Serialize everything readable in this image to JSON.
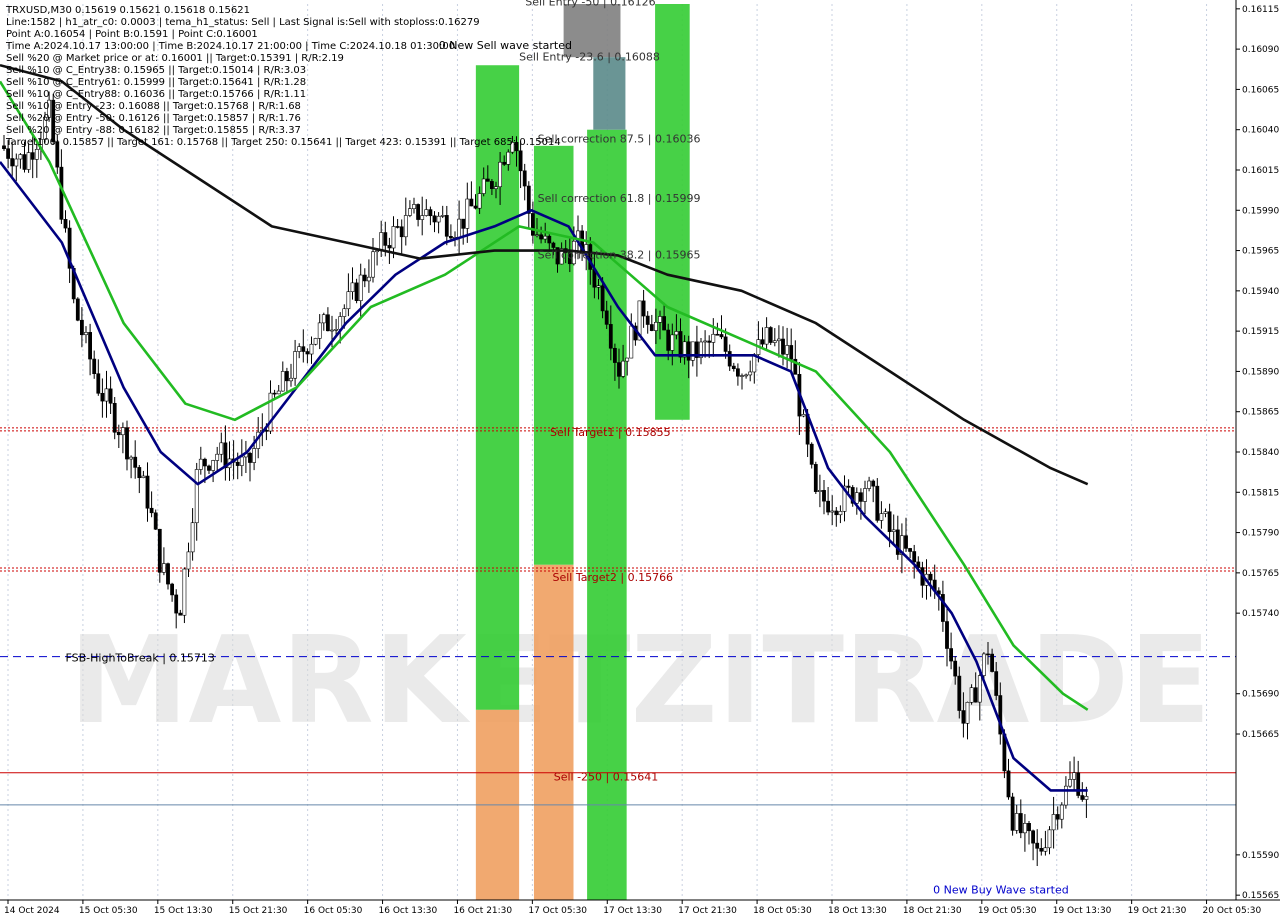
{
  "header": {
    "lines": [
      "TRXUSD,M30  0.15619 0.15621 0.15618 0.15621",
      "Line:1582 | h1_atr_c0: 0.0003 | tema_h1_status: Sell | Last Signal is:Sell with stoploss:0.16279",
      "Point A:0.16054 | Point B:0.1591 | Point C:0.16001",
      "Time A:2024.10.17 13:00:00 | Time B:2024.10.17 21:00:00 | Time C:2024.10.18 01:30:00",
      "Sell %20 @ Market price or at: 0.16001 || Target:0.15391 | R/R:2.19",
      "Sell %10 @ C_Entry38: 0.15965 || Target:0.15014 | R/R:3.03",
      "Sell %10 @ C_Entry61: 0.15999 || Target:0.15641 | R/R:1.28",
      "Sell %10 @ C_Entry88: 0.16036 || Target:0.15766 | R/R:1.11",
      "Sell %10 @ Entry -23: 0.16088 || Target:0.15768 | R/R:1.68",
      "Sell %20 @ Entry -50: 0.16126 || Target:0.15857 | R/R:1.76",
      "Sell %20 @ Entry -88: 0.16182 || Target:0.15855 | R/R:3.37",
      "Target100: 0.15857 || Target 161: 0.15768 || Target 250: 0.15641 || Target 423: 0.15391 || Target 685: 0.15014"
    ]
  },
  "chart_data": {
    "type": "candlestick",
    "symbol": "TRXUSD",
    "timeframe": "M30",
    "ylim": [
      0.15562,
      0.16118
    ],
    "price_ticks": [
      0.16115,
      0.1609,
      0.16065,
      0.1604,
      0.16015,
      0.1599,
      0.15965,
      0.1594,
      0.15915,
      0.1589,
      0.15865,
      0.1584,
      0.15815,
      0.1579,
      0.15765,
      0.1574,
      0.1569,
      0.15665,
      0.1559,
      0.15565
    ],
    "time_ticks": [
      "14 Oct 2024",
      "15 Oct 05:30",
      "15 Oct 13:30",
      "15 Oct 21:30",
      "16 Oct 05:30",
      "16 Oct 13:30",
      "16 Oct 21:30",
      "17 Oct 05:30",
      "17 Oct 13:30",
      "17 Oct 21:30",
      "18 Oct 05:30",
      "18 Oct 13:30",
      "18 Oct 21:30",
      "19 Oct 05:30",
      "19 Oct 13:30",
      "19 Oct 21:30",
      "20 Oct 05:30"
    ],
    "price_path": [
      [
        0,
        0.1603
      ],
      [
        0.02,
        0.1602
      ],
      [
        0.04,
        0.1605
      ],
      [
        0.06,
        0.1593
      ],
      [
        0.08,
        0.1588
      ],
      [
        0.1,
        0.1585
      ],
      [
        0.12,
        0.1581
      ],
      [
        0.13,
        0.1577
      ],
      [
        0.145,
        0.1574
      ],
      [
        0.16,
        0.1583
      ],
      [
        0.175,
        0.1584
      ],
      [
        0.2,
        0.1583
      ],
      [
        0.22,
        0.1587
      ],
      [
        0.25,
        0.1591
      ],
      [
        0.28,
        0.1593
      ],
      [
        0.31,
        0.1597
      ],
      [
        0.34,
        0.1599
      ],
      [
        0.37,
        0.1598
      ],
      [
        0.4,
        0.1601
      ],
      [
        0.415,
        0.1604
      ],
      [
        0.43,
        0.1598
      ],
      [
        0.45,
        0.1596
      ],
      [
        0.47,
        0.1597
      ],
      [
        0.49,
        0.1593
      ],
      [
        0.5,
        0.1589
      ],
      [
        0.52,
        0.1593
      ],
      [
        0.54,
        0.1591
      ],
      [
        0.56,
        0.159
      ],
      [
        0.58,
        0.1591
      ],
      [
        0.6,
        0.1589
      ],
      [
        0.62,
        0.1591
      ],
      [
        0.64,
        0.159
      ],
      [
        0.66,
        0.1581
      ],
      [
        0.68,
        0.1581
      ],
      [
        0.7,
        0.1582
      ],
      [
        0.72,
        0.1579
      ],
      [
        0.74,
        0.1577
      ],
      [
        0.76,
        0.1575
      ],
      [
        0.78,
        0.1567
      ],
      [
        0.8,
        0.1572
      ],
      [
        0.81,
        0.1566
      ],
      [
        0.82,
        0.1561
      ],
      [
        0.84,
        0.1559
      ],
      [
        0.855,
        0.1562
      ],
      [
        0.87,
        0.1564
      ],
      [
        0.88,
        0.1562
      ]
    ],
    "series": [
      {
        "name": "blue",
        "color": "#000080",
        "values": [
          [
            0,
            0.1602
          ],
          [
            0.05,
            0.1597
          ],
          [
            0.1,
            0.1588
          ],
          [
            0.13,
            0.1584
          ],
          [
            0.16,
            0.1582
          ],
          [
            0.2,
            0.1584
          ],
          [
            0.24,
            0.1588
          ],
          [
            0.28,
            0.1592
          ],
          [
            0.32,
            0.1595
          ],
          [
            0.36,
            0.1597
          ],
          [
            0.4,
            0.1598
          ],
          [
            0.43,
            0.1599
          ],
          [
            0.46,
            0.1598
          ],
          [
            0.5,
            0.1593
          ],
          [
            0.53,
            0.159
          ],
          [
            0.57,
            0.159
          ],
          [
            0.61,
            0.159
          ],
          [
            0.64,
            0.1589
          ],
          [
            0.67,
            0.1583
          ],
          [
            0.7,
            0.158
          ],
          [
            0.74,
            0.1577
          ],
          [
            0.77,
            0.1574
          ],
          [
            0.79,
            0.1571
          ],
          [
            0.82,
            0.1565
          ],
          [
            0.85,
            0.1563
          ],
          [
            0.88,
            0.1563
          ]
        ]
      },
      {
        "name": "green",
        "color": "#22bb22",
        "values": [
          [
            0,
            0.1607
          ],
          [
            0.04,
            0.1602
          ],
          [
            0.1,
            0.1592
          ],
          [
            0.15,
            0.1587
          ],
          [
            0.19,
            0.1586
          ],
          [
            0.24,
            0.1588
          ],
          [
            0.3,
            0.1593
          ],
          [
            0.36,
            0.1595
          ],
          [
            0.42,
            0.1598
          ],
          [
            0.48,
            0.1597
          ],
          [
            0.54,
            0.1593
          ],
          [
            0.6,
            0.1591
          ],
          [
            0.66,
            0.1589
          ],
          [
            0.72,
            0.1584
          ],
          [
            0.78,
            0.1577
          ],
          [
            0.82,
            0.1572
          ],
          [
            0.86,
            0.1569
          ],
          [
            0.88,
            0.1568
          ]
        ]
      },
      {
        "name": "black",
        "color": "#111111",
        "values": [
          [
            0,
            0.1608
          ],
          [
            0.05,
            0.1607
          ],
          [
            0.1,
            0.1604
          ],
          [
            0.16,
            0.1601
          ],
          [
            0.22,
            0.1598
          ],
          [
            0.28,
            0.1597
          ],
          [
            0.34,
            0.1596
          ],
          [
            0.4,
            0.15965
          ],
          [
            0.46,
            0.15965
          ],
          [
            0.5,
            0.15962
          ],
          [
            0.54,
            0.1595
          ],
          [
            0.6,
            0.1594
          ],
          [
            0.66,
            0.1592
          ],
          [
            0.72,
            0.1589
          ],
          [
            0.78,
            0.1586
          ],
          [
            0.85,
            0.1583
          ],
          [
            0.88,
            0.1582
          ]
        ]
      }
    ],
    "levels": [
      {
        "label": "0.15855",
        "value": 0.15855,
        "color": "#cc0000",
        "style": "dotted"
      },
      {
        "label": "0.15768",
        "value": 0.15768,
        "color": "#cc0000",
        "style": "dotted"
      },
      {
        "label": "0.15713",
        "value": 0.15713,
        "color": "#0000cc",
        "style": "dashed"
      },
      {
        "label": "0.15641",
        "value": 0.15641,
        "color": "#cc0000",
        "style": "solid"
      },
      {
        "label": "0.15621",
        "value": 0.15621,
        "color": "#6688aa",
        "style": "solid",
        "current": true
      }
    ],
    "zones": [
      {
        "color": "#33cc33",
        "x": 0.385,
        "w": 0.035,
        "y_top": 0.1608,
        "y_bot": 0.1568
      },
      {
        "color": "#f0a060",
        "x": 0.385,
        "w": 0.035,
        "y_top": 0.1568,
        "y_bot": 0.15562
      },
      {
        "color": "#33cc33",
        "x": 0.432,
        "w": 0.032,
        "y_top": 0.1603,
        "y_bot": 0.1577
      },
      {
        "color": "#f0a060",
        "x": 0.432,
        "w": 0.032,
        "y_top": 0.1577,
        "y_bot": 0.15562
      },
      {
        "color": "#33cc33",
        "x": 0.475,
        "w": 0.032,
        "y_top": 0.1604,
        "y_bot": 0.15562
      },
      {
        "color": "#33cc33",
        "x": 0.53,
        "w": 0.028,
        "y_top": 0.16118,
        "y_bot": 0.1586
      },
      {
        "color": "#808080",
        "x": 0.456,
        "w": 0.046,
        "y_top": 0.16118,
        "y_bot": 0.16085
      },
      {
        "color": "#5a8a8a",
        "x": 0.48,
        "w": 0.026,
        "y_top": 0.16085,
        "y_bot": 0.1604
      }
    ],
    "labels": [
      {
        "text": "0 New Sell wave started",
        "x": 0.355,
        "y": 0.1609,
        "color": "#000"
      },
      {
        "text": "Sell Entry -23.6 | 0.16088",
        "x": 0.42,
        "y": 0.16083,
        "color": "#333"
      },
      {
        "text": "Sell Entry -50 | 0.16126",
        "x": 0.425,
        "y": 0.16117,
        "color": "#333"
      },
      {
        "text": "Sell correction 87.5 | 0.16036",
        "x": 0.435,
        "y": 0.16032,
        "color": "#333"
      },
      {
        "text": "Sell correction 61.8 | 0.15999",
        "x": 0.435,
        "y": 0.15995,
        "color": "#333"
      },
      {
        "text": "Sell correction 38.2 | 0.15965",
        "x": 0.435,
        "y": 0.1596,
        "color": "#333"
      },
      {
        "text": "Sell Target1 | 0.15855",
        "x": 0.445,
        "y": 0.1585,
        "color": "#aa0000"
      },
      {
        "text": "Sell Target2 | 0.15766",
        "x": 0.447,
        "y": 0.1576,
        "color": "#aa0000"
      },
      {
        "text": "Sell -250 | 0.15641",
        "x": 0.448,
        "y": 0.15636,
        "color": "#aa0000"
      },
      {
        "text": "FSB-HighToBreak | 0.15713",
        "x": 0.053,
        "y": 0.1571,
        "color": "#000"
      },
      {
        "text": "0 New Buy Wave started",
        "x": 0.755,
        "y": 0.15566,
        "color": "#0000cc"
      }
    ]
  }
}
